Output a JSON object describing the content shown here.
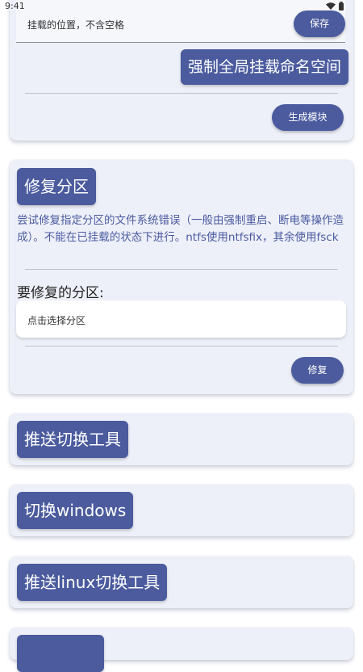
{
  "status_bar": {
    "time": "9:41"
  },
  "mount_card": {
    "input_placeholder": "挂载的位置，不含空格",
    "save_label": "保存",
    "force_global_label": "强制全局挂载命名空间",
    "generate_module_label": "生成模块"
  },
  "repair_card": {
    "title": "修复分区",
    "description": "尝试修复指定分区的文件系统错误（一般由强制重启、断电等操作造成）。不能在已挂载的状态下进行。ntfs使用ntfsfix，其余使用fsck",
    "partition_label": "要修复的分区:",
    "select_placeholder": "点击选择分区",
    "repair_label": "修复"
  },
  "push_tool_card": {
    "title": "推送切换工具"
  },
  "switch_windows_card": {
    "title": "切换windows"
  },
  "push_linux_card": {
    "title": "推送linux切换工具"
  },
  "colors": {
    "accent": "#4b5b9e",
    "card_bg": "#eef0f9",
    "desc_text": "#4a5aa0"
  }
}
